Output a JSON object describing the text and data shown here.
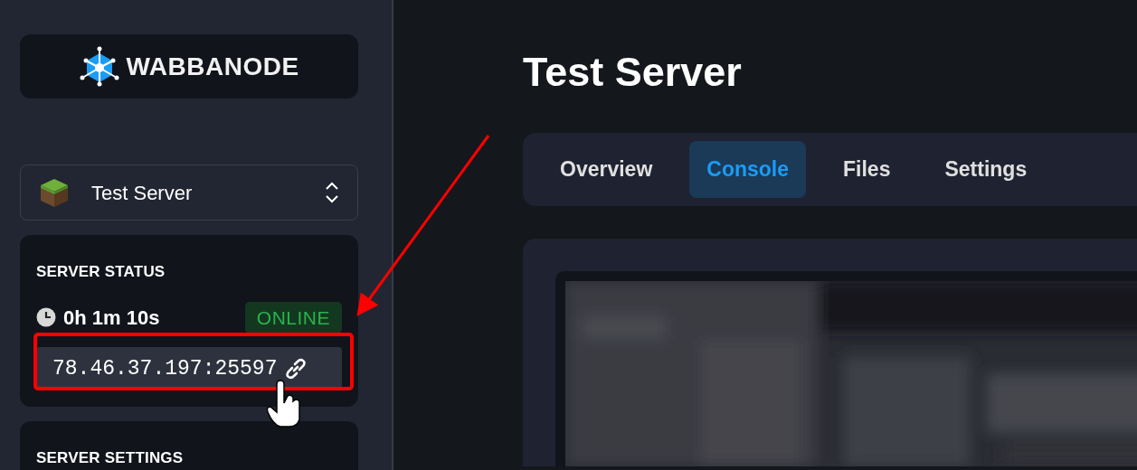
{
  "logo": {
    "text": "WABBANODE"
  },
  "server_selector": {
    "name": "Test Server"
  },
  "server_status": {
    "heading": "SERVER STATUS",
    "uptime": "0h 1m 10s",
    "status": "ONLINE",
    "online": true,
    "address": "78.46.37.197:25597"
  },
  "server_settings": {
    "heading": "SERVER SETTINGS"
  },
  "page_title": "Test Server",
  "tabs": [
    {
      "label": "Overview",
      "selected": false
    },
    {
      "label": "Console",
      "selected": true
    },
    {
      "label": "Files",
      "selected": false
    },
    {
      "label": "Settings",
      "selected": false
    }
  ]
}
